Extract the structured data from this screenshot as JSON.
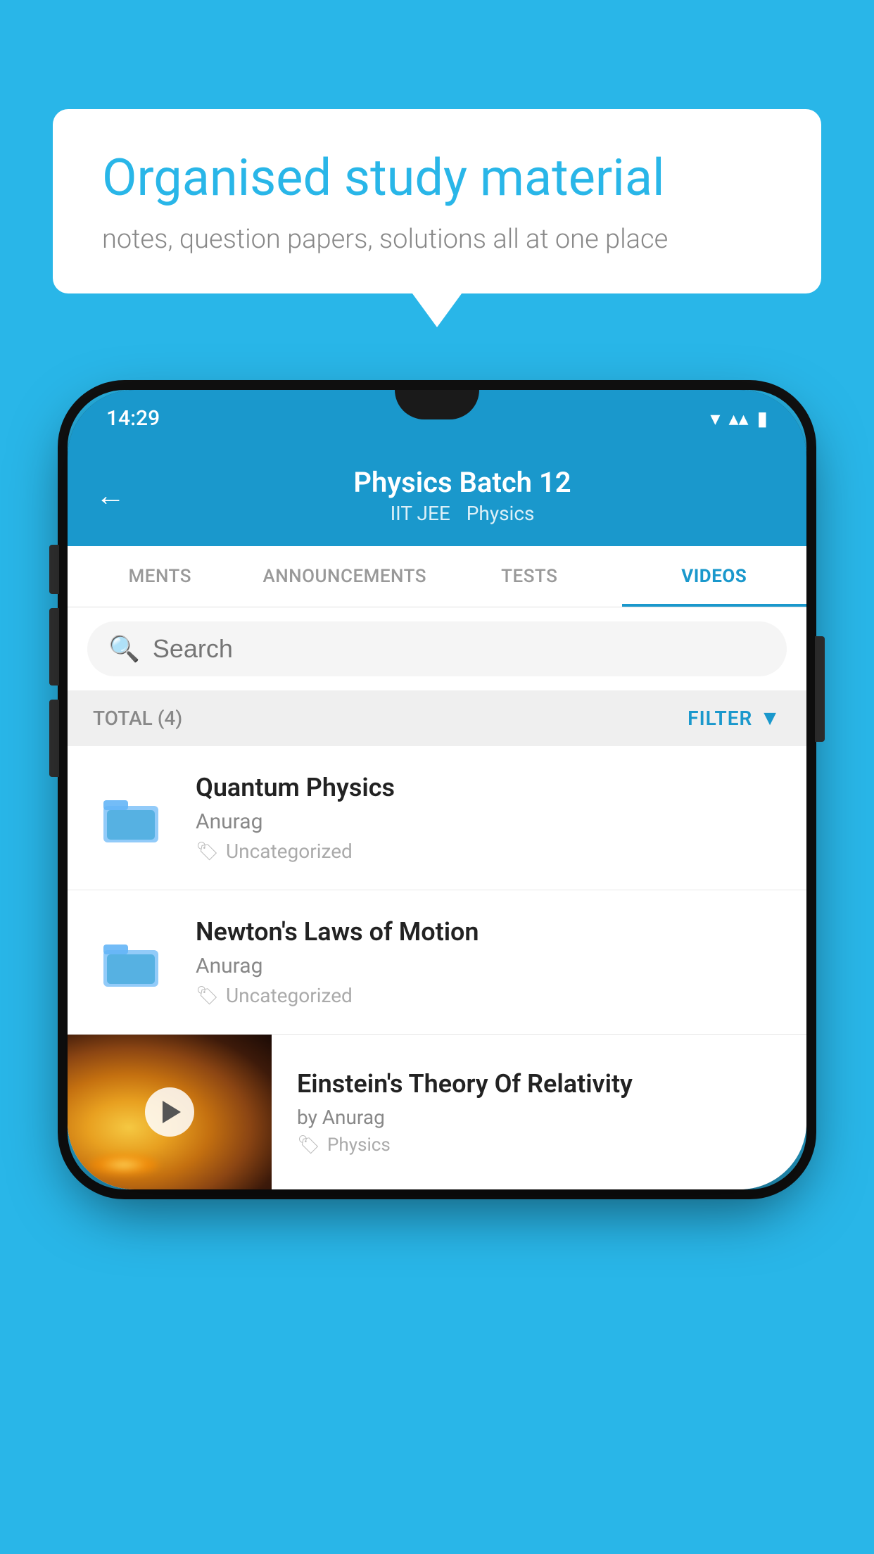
{
  "background_color": "#29b6e8",
  "speech_bubble": {
    "heading": "Organised study material",
    "subtext": "notes, question papers, solutions all at one place"
  },
  "status_bar": {
    "time": "14:29",
    "wifi": "▾",
    "signal": "▴",
    "battery": "▮"
  },
  "app_bar": {
    "title": "Physics Batch 12",
    "subtitle1": "IIT JEE",
    "subtitle2": "Physics",
    "back_label": "←"
  },
  "tabs": [
    {
      "label": "MENTS",
      "active": false
    },
    {
      "label": "ANNOUNCEMENTS",
      "active": false
    },
    {
      "label": "TESTS",
      "active": false
    },
    {
      "label": "VIDEOS",
      "active": true
    }
  ],
  "search": {
    "placeholder": "Search"
  },
  "filter_bar": {
    "total": "TOTAL (4)",
    "filter_label": "FILTER"
  },
  "videos": [
    {
      "title": "Quantum Physics",
      "author": "Anurag",
      "tag": "Uncategorized",
      "has_thumb": false
    },
    {
      "title": "Newton's Laws of Motion",
      "author": "Anurag",
      "tag": "Uncategorized",
      "has_thumb": false
    },
    {
      "title": "Einstein's Theory Of Relativity",
      "author": "by Anurag",
      "tag": "Physics",
      "has_thumb": true
    }
  ]
}
